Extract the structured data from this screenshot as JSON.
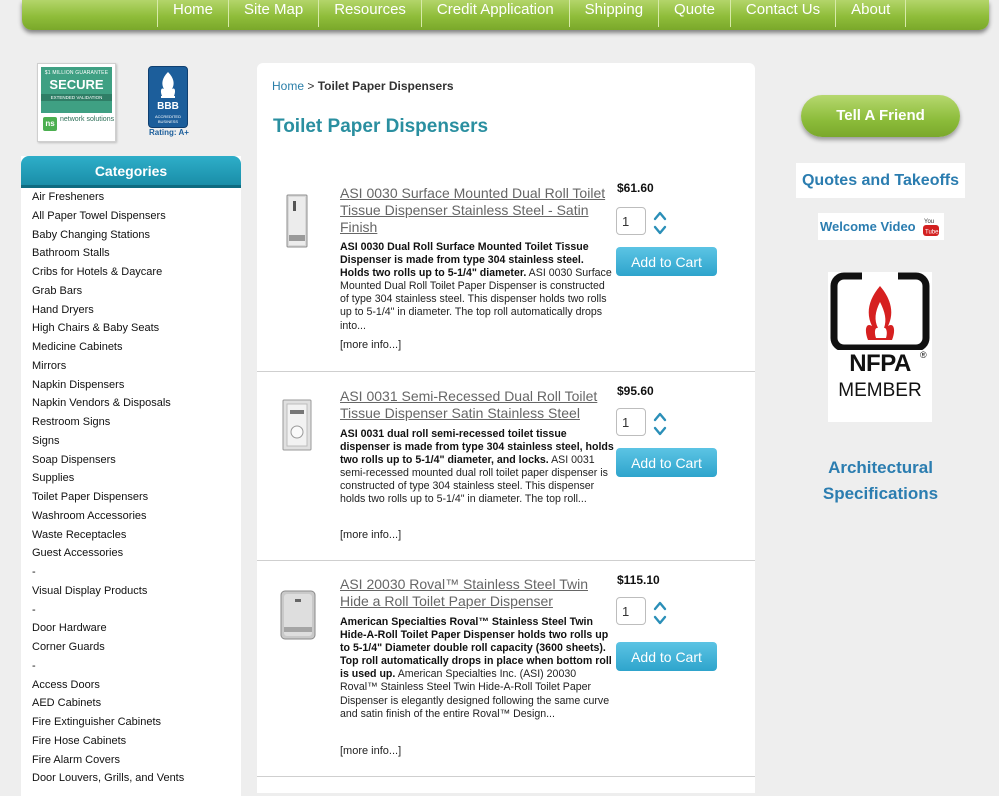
{
  "nav": {
    "items": [
      {
        "label": "Home"
      },
      {
        "label": "Site Map"
      },
      {
        "label": "Resources"
      },
      {
        "label": "Credit Application"
      },
      {
        "label": "Shipping"
      },
      {
        "label": "Quote"
      },
      {
        "label": "Contact Us"
      },
      {
        "label": "About"
      }
    ]
  },
  "badges": {
    "secure": {
      "guarantee": "$1 MILLION GUARANTEE",
      "title": "SECURE",
      "subtitle": "EXTENDED VALIDATION",
      "vendor": "network solutions"
    },
    "bbb": {
      "title": "BBB",
      "accredited": "ACCREDITED BUSINESS",
      "rating": "Rating: A+"
    }
  },
  "categories": {
    "title": "Categories",
    "items": [
      "Air Fresheners",
      "All Paper Towel Dispensers",
      "Baby Changing Stations",
      "Bathroom Stalls",
      "Cribs for Hotels & Daycare",
      "Grab Bars",
      "Hand Dryers",
      "High Chairs & Baby Seats",
      "Medicine Cabinets",
      "Mirrors",
      "Napkin Dispensers",
      "Napkin Vendors & Disposals",
      "Restroom Signs",
      "Signs",
      "Soap Dispensers",
      "Supplies",
      "Toilet Paper Dispensers",
      "Washroom Accessories",
      "Waste Receptacles",
      "Guest Accessories",
      "-",
      "Visual Display Products",
      "-",
      "Door Hardware",
      "Corner Guards",
      "-",
      "Access Doors",
      "AED Cabinets",
      "Fire Extinguisher Cabinets",
      "Fire Hose Cabinets",
      "Fire Alarm Covers",
      "Door Louvers, Grills, and Vents"
    ]
  },
  "breadcrumb": {
    "home": "Home",
    "sep": ">",
    "current": "Toilet Paper Dispensers"
  },
  "page_title": "Toilet Paper Dispensers",
  "products": [
    {
      "title": "ASI 0030 Surface Mounted Dual Roll Toilet Tissue Dispenser Stainless Steel - Satin Finish",
      "desc_bold": "ASI 0030 Dual Roll Surface Mounted Toilet Tissue Dispenser is made from type 304 stainless steel. Holds two rolls up to 5-1/4\" diameter.",
      "desc_rest": " ASI 0030 Surface Mounted Dual Roll Toilet Paper Dispenser is constructed of type 304 stainless steel. This dispenser holds two rolls up to 5-1/4\" in diameter. The top roll automatically drops into...",
      "more": "[more info...]",
      "price": "$61.60",
      "qty": "1",
      "cart_label": "Add to Cart"
    },
    {
      "title": "ASI 0031 Semi-Recessed Dual Roll Toilet Tissue Dispenser Satin Stainless Steel",
      "desc_bold": "ASI 0031 dual roll semi-recessed toilet tissue dispenser is made from type 304 stainless steel, holds two rolls up to 5-1/4\" diameter, and locks.",
      "desc_rest": " ASI 0031 semi-recessed mounted dual roll toilet paper dispenser is constructed of type 304 stainless steel. This dispenser holds two rolls up to 5-1/4\" in diameter. The top roll...",
      "more": "[more info...]",
      "price": "$95.60",
      "qty": "1",
      "cart_label": "Add to Cart"
    },
    {
      "title": "ASI 20030 Roval™ Stainless Steel Twin Hide a Roll Toilet Paper Dispenser",
      "desc_bold": "American Specialties Roval™ Stainless Steel Twin Hide-A-Roll Toilet Paper Dispenser holds two rolls up to 5-1/4\" Diameter double roll capacity (3600 sheets). Top roll automatically drops in place when bottom roll is used up.",
      "desc_rest": " American Specialties Inc. (ASI) 20030 Roval™ Stainless Steel Twin Hide-A-Roll Toilet Paper Dispenser is elegantly designed following the same curve and satin finish of the entire Roval™ Design...",
      "more": "[more info...]",
      "price": "$115.10",
      "qty": "1",
      "cart_label": "Add to Cart"
    }
  ],
  "right": {
    "tell_friend": "Tell A Friend",
    "quotes": "Quotes and Takeoffs",
    "welcome_video": "Welcome Video",
    "youtube_text": "You Tube",
    "nfpa": {
      "name": "NFPA",
      "reg": "®",
      "member": "MEMBER"
    },
    "arch_line1": "Architectural",
    "arch_line2": "Specifications"
  },
  "colors": {
    "nav_green": "#8fbd3a",
    "teal_header": "#1a8ea8",
    "title_teal": "#2a8fa0",
    "link_blue": "#2b7db0",
    "cart_blue": "#2ea4cc"
  }
}
